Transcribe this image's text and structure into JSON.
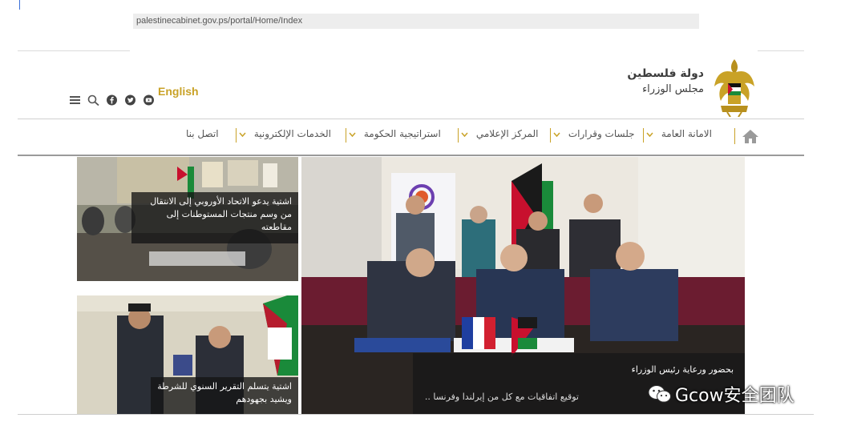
{
  "browser": {
    "url": "palestinecabinet.gov.ps/portal/Home/Index"
  },
  "header": {
    "brand_line1": "دولة فلسطين",
    "brand_line2": "مجلس الوزراء",
    "language_link": "English",
    "icons": [
      "menu-icon",
      "search-icon",
      "facebook-icon",
      "twitter-icon",
      "youtube-icon"
    ],
    "accent_color": "#c9a227"
  },
  "nav": {
    "items": [
      {
        "label": "الامانة العامة",
        "has_dropdown": true
      },
      {
        "label": "جلسات وقرارات",
        "has_dropdown": true
      },
      {
        "label": "المركز الإعلامي",
        "has_dropdown": true
      },
      {
        "label": "استراتيجية الحكومة",
        "has_dropdown": true
      },
      {
        "label": "الخدمات الإلكترونية",
        "has_dropdown": true
      },
      {
        "label": "اتصل بنا",
        "has_dropdown": false
      }
    ]
  },
  "news": {
    "side_top": "اشتية يدعو الاتحاد الأوروبي إلى الانتقال من وسم منتجات المستوطنات إلى مقاطعته",
    "side_bottom": "اشتية يتسلم التقرير السنوي للشرطة ويشيد بجهودهم",
    "main_line1": "بحضور ورعاية رئيس الوزراء",
    "main_line2": "توقيع اتفاقيات مع كل من إيرلندا وفرنسا .."
  },
  "watermark": {
    "text": "Gcow安全团队"
  }
}
